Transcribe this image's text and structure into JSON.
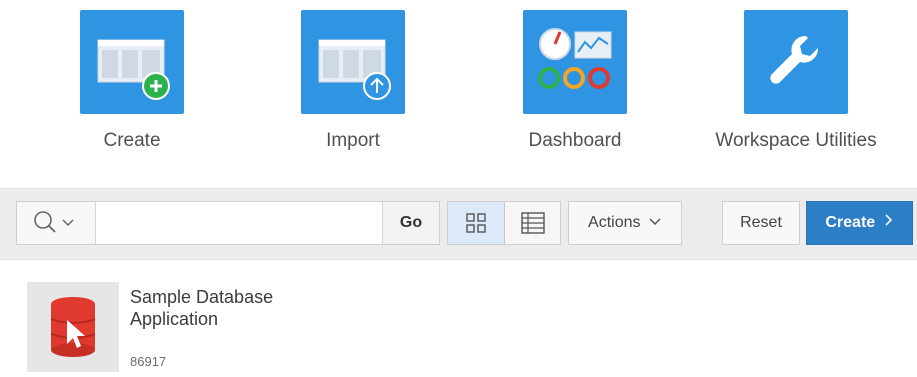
{
  "tiles": [
    {
      "label": "Create",
      "icon": "create-app-icon"
    },
    {
      "label": "Import",
      "icon": "import-app-icon"
    },
    {
      "label": "Dashboard",
      "icon": "dashboard-icon"
    },
    {
      "label": "Workspace Utilities",
      "icon": "wrench-icon"
    }
  ],
  "toolbar": {
    "search": {
      "value": "",
      "placeholder": ""
    },
    "go_label": "Go",
    "actions_label": "Actions",
    "reset_label": "Reset",
    "create_label": "Create"
  },
  "apps": [
    {
      "name": "Sample Database Application",
      "id": "86917"
    }
  ],
  "colors": {
    "tile_blue": "#2f94e2",
    "create_button": "#2c7ec6",
    "selected_view": "#dbe9f8",
    "app_icon_red": "#e03a2f"
  }
}
